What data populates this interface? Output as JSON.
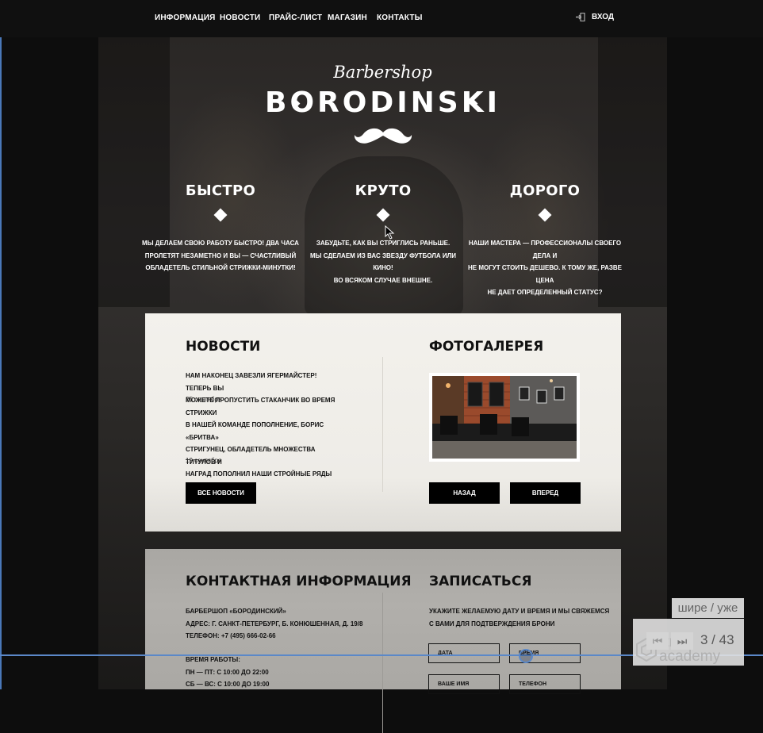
{
  "nav": {
    "items": [
      "ИНФОРМАЦИЯ",
      "НОВОСТИ",
      "ПРАЙС-ЛИСТ",
      "МАГАЗИН",
      "КОНТАКТЫ"
    ],
    "login": "ВХОД"
  },
  "logo": {
    "script": "Barbershop",
    "main": "BORODINSKI"
  },
  "features": [
    {
      "title": "БЫСТРО",
      "lines": [
        "МЫ ДЕЛАЕМ СВОЮ РАБОТУ БЫСТРО! ДВА ЧАСА",
        "ПРОЛЕТЯТ НЕЗАМЕТНО И ВЫ — СЧАСТЛИВЫЙ",
        "ОБЛАДЕТЕЛЬ СТИЛЬНОЙ СТРИЖКИ-МИНУТКИ!"
      ]
    },
    {
      "title": "КРУТО",
      "lines": [
        "ЗАБУДЬТЕ, КАК ВЫ СТРИГЛИСЬ РАНЬШЕ.",
        "МЫ СДЕЛАЕМ ИЗ ВАС ЗВЕЗДУ ФУТБОЛА ИЛИ КИНО!",
        "ВО ВСЯКОМ СЛУЧАЕ ВНЕШНЕ."
      ]
    },
    {
      "title": "ДОРОГО",
      "lines": [
        "НАШИ МАСТЕРА — ПРОФЕССИОНАЛЫ СВОЕГО ДЕЛА И",
        "НЕ МОГУТ СТОИТЬ ДЕШЕВО. К ТОМУ ЖЕ, РАЗВЕ ЦЕНА",
        "НЕ ДАЕТ ОПРЕДЕЛЕННЫЙ СТАТУС?"
      ]
    }
  ],
  "news": {
    "title": "НОВОСТИ",
    "items": [
      {
        "lines": [
          "НАМ НАКОНЕЦ ЗАВЕЗЛИ ЯГЕРМАЙСТЕР! ТЕПЕРЬ ВЫ",
          "МОЖЕТЕ ПРОПУСТИТЬ СТАКАНЧИК ВО ВРЕМЯ СТРИЖКИ"
        ],
        "date": "25 сентября"
      },
      {
        "lines": [
          "В НАШЕЙ КОМАНДЕ ПОПОЛНЕНИЕ, БОРИС «БРИТВА»",
          "СТРИГУНЕЦ, ОБЛАДЕТЕЛЬ МНОЖЕСТВА ТИТУЛОВ И",
          "НАГРАД ПОПОЛНИЛ НАШИ СТРОЙНЫЕ РЯДЫ"
        ],
        "date": "19 сентября"
      }
    ],
    "all_button": "ВСЕ НОВОСТИ"
  },
  "gallery": {
    "title": "ФОТОГАЛЕРЕЯ",
    "prev_button": "НАЗАД",
    "next_button": "ВПЕРЕД"
  },
  "contacts": {
    "title": "КОНТАКТНАЯ ИНФОРМАЦИЯ",
    "lines": [
      "БАРБЕРШОП «БОРОДИНСКИЙ»",
      "АДРЕС: Г. САНКТ-ПЕТЕРБУРГ, Б. КОНЮШЕННАЯ, Д. 19/8",
      "ТЕЛЕФОН: +7 (495) 666-02-66"
    ],
    "hours_lines": [
      "ВРЕМЯ РАБОТЫ:",
      "ПН — ПТ: С 10:00 ДО 22:00",
      "СБ — ВС: С 10:00 ДО 19:00"
    ]
  },
  "booking": {
    "title": "ЗАПИСАТЬСЯ",
    "lines": [
      "УКАЖИТЕ ЖЕЛАЕМУЮ ДАТУ И ВРЕМЯ И МЫ СВЯЖЕМСЯ",
      "С ВАМИ ДЛЯ ПОДТВЕРЖДЕНИЯ БРОНИ"
    ],
    "date_placeholder": "ДАТА",
    "time_placeholder": "ВРЕМЯ",
    "name_placeholder": "ВАШЕ ИМЯ",
    "phone_placeholder": "ТЕЛЕФОН"
  },
  "player": {
    "toggle_label": "шире / уже",
    "counter": "3 / 43",
    "watermark_top": "html",
    "watermark_bottom": "academy",
    "back_glyph": "⏮",
    "forward_glyph": "⏭"
  },
  "colors": {
    "player_accent": "#5b88c8",
    "panel_bg": "#f3f1ec",
    "button_bg": "#000000"
  }
}
